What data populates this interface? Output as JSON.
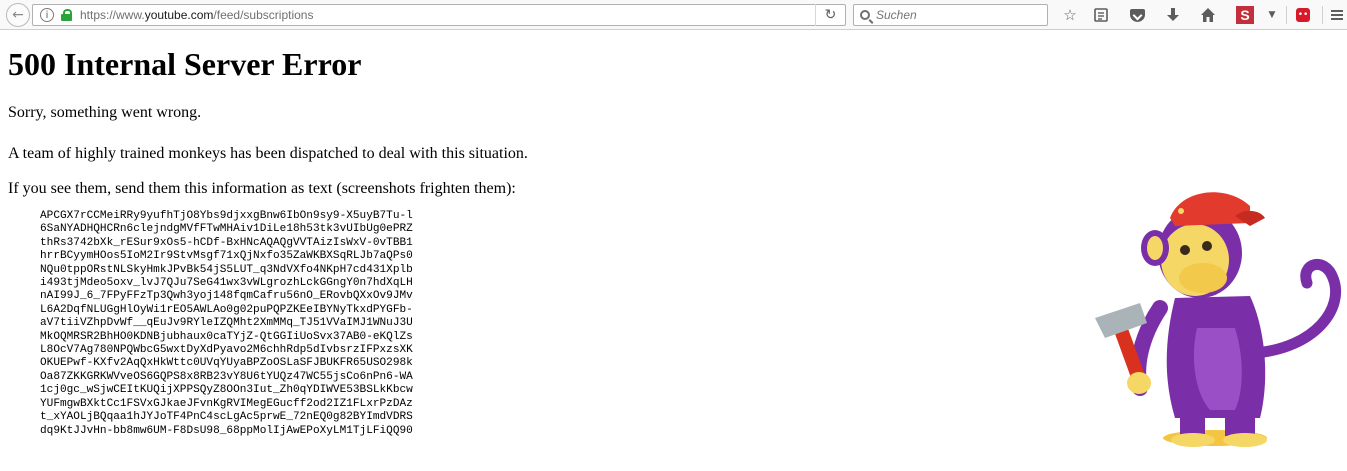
{
  "browser": {
    "url_prefix": "https://www.",
    "url_domain": "youtube.com",
    "url_path": "/feed/subscriptions",
    "search_placeholder": "Suchen",
    "extension_s_label": "S"
  },
  "page": {
    "heading": "500 Internal Server Error",
    "line1": "Sorry, something went wrong.",
    "line2": "A team of highly trained monkeys has been dispatched to deal with this situation.",
    "line3": "If you see them, send them this information as text (screenshots frighten them):",
    "error_lines": [
      "APCGX7rCCMeiRRy9yufhTjO8Ybs9djxxgBnw6IbOn9sy9-X5uyB7Tu-l",
      "6SaNYADHQHCRn6clejndgMVfFTwMHAiv1DiLe18h53tk3vUIbUg0ePRZ",
      "thRs3742bXk_rESur9xOs5-hCDf-BxHNcAQAQgVVTAizIsWxV-0vTBB1",
      "hrrBCyymHOos5IoM2Ir9StvMsgf71xQjNxfo35ZaWKBXSqRLJb7aQPs0",
      "NQu0tppORstNLSkyHmkJPvBk54jS5LUT_q3NdVXfo4NKpH7cd431Xplb",
      "i493tjMdeo5oxv_lvJ7QJu7SeG41wx3vWLgrozhLckGGngY0n7hdXqLH",
      "nAI99J_6_7FPyFFzTp3Qwh3yoj148fqmCafru56nO_ERovbQXxOv9JMv",
      "L6A2DqfNLUGgHlOyWi1rEO5AWLAo0g02puPQPZKEeIBYNyTkxdPYGFb-",
      "aV7tiiVZhpDvWf__qEuJv9RYleIZQMht2XmMMq_TJ51VVaIMJ1WNuJ3U",
      "MkOQMRSR2BhHO0KDNBjubhaux0caTYjZ-QtGGIiUoSvx37AB0-eKQlZs",
      "L8OcV7Ag780NPQWbcG5wxtDyXdPyavo2M6chhRdp5dIvbsrzIFPxzsXK",
      "OKUEPwf-KXfv2AqQxHkWttc0UVqYUyaBPZoOSLaSFJBUKFR65USO298k",
      "Oa87ZKKGRKWVveOS6GQPS8x8RB23vY8U6tYUQz47WC55jsCo6nPn6-WA",
      "1cj0gc_wSjwCEItKUQijXPPSQyZ8OOn3Iut_Zh0qYDIWVE53BSLkKbcw",
      "YUFmgwBXktCc1FSVxGJkaeJFvnKgRVIMegEGucff2od2IZ1FLxrPzDAz",
      "t_xYAOLjBQqaa1hJYJoTF4PnC4scLgAc5prwE_72nEQ0g82BYImdVDRS",
      "dq9KtJJvHn-bb8mw6UM-F8DsU98_68ppMolIjAwEPoXyLM1TjLFiQQ90"
    ]
  },
  "colors": {
    "lock_green": "#2aa339",
    "monkey_purple": "#7a2fa8",
    "monkey_face": "#f5d766",
    "cap_red": "#e23b2e",
    "hammer_red": "#d8321f",
    "floor_yellow": "#f4c542"
  },
  "icons": [
    "back-arrow-icon",
    "info-icon",
    "lock-icon",
    "reload-icon",
    "search-icon",
    "bookmark-star-icon",
    "reading-list-icon",
    "pocket-icon",
    "download-icon",
    "home-icon",
    "extension-s-icon",
    "extension-menu-icon",
    "addon-red-icon",
    "hamburger-menu-icon"
  ]
}
